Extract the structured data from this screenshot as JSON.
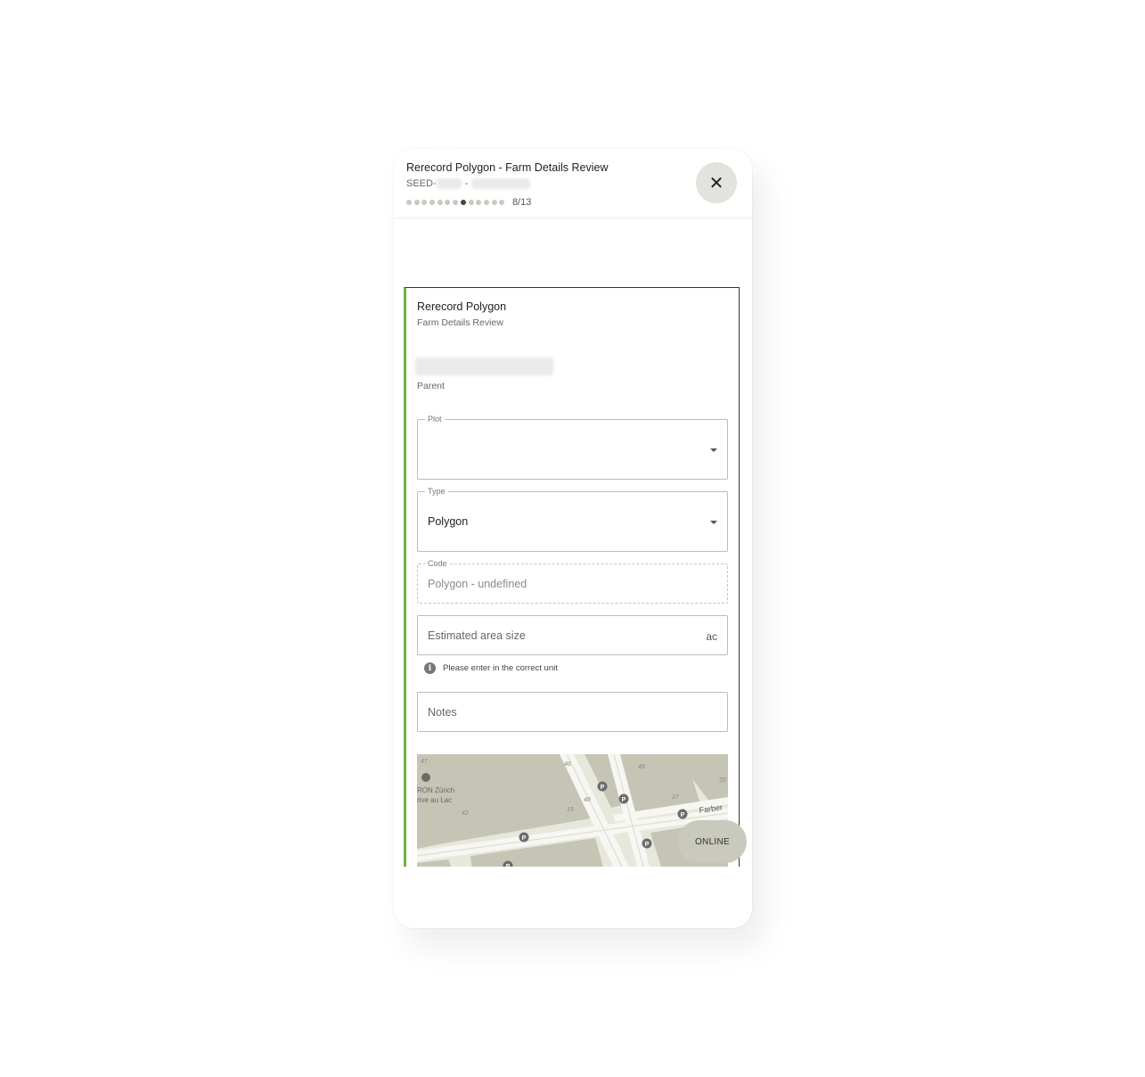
{
  "header": {
    "title": "Rerecord Polygon - Farm Details Review",
    "subtitle_prefix": "SEED-",
    "subtitle_separator": "-",
    "progress": {
      "current": 8,
      "total": 13,
      "label": "8/13"
    }
  },
  "close_button": {
    "icon": "close-icon",
    "glyph": "✕"
  },
  "card": {
    "title": "Rerecord Polygon",
    "subtitle": "Farm Details Review",
    "parent_label": "Parent",
    "accent_color": "#6bb33a"
  },
  "fields": {
    "plot": {
      "label": "Plot",
      "value": ""
    },
    "type": {
      "label": "Type",
      "value": "Polygon"
    },
    "code": {
      "label": "Code",
      "value": "Polygon - undefined"
    },
    "area": {
      "placeholder": "Estimated area size",
      "unit": "ac",
      "helper": "Please enter in the correct unit"
    },
    "notes": {
      "placeholder": "Notes"
    }
  },
  "map": {
    "labels": {
      "poi_line1": "RON Zürich",
      "poi_line2": "rive au Lac",
      "street": "Farber",
      "numbers": [
        "47",
        "46",
        "49",
        "27",
        "42",
        "15",
        "48",
        "33"
      ],
      "parking": "P"
    }
  },
  "status_button": {
    "label": "ONLINE"
  }
}
